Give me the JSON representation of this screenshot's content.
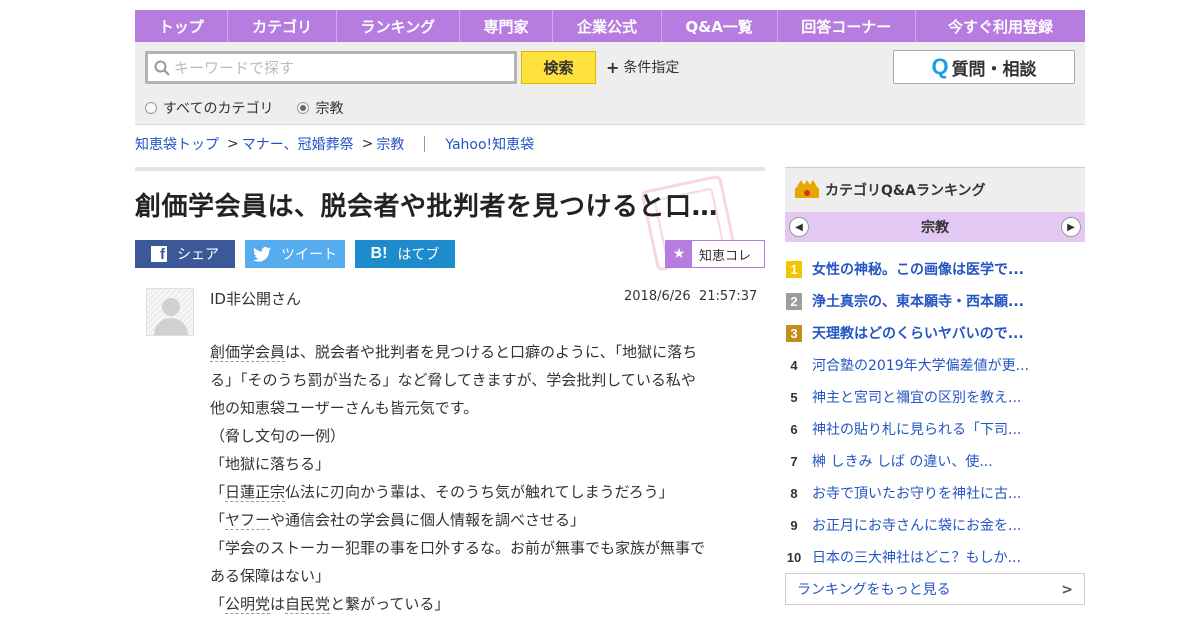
{
  "nav": {
    "items": [
      "トップ",
      "カテゴリ",
      "ランキング",
      "専門家",
      "企業公式",
      "Q&A一覧",
      "回答コーナー",
      "今すぐ利用登録"
    ]
  },
  "search": {
    "placeholder": "キーワードで探す",
    "value": "",
    "button_label": "検索",
    "condition_label": "条件指定",
    "ask_button_label": "質問・相談",
    "ask_icon": "Q",
    "scope_options": [
      "すべてのカテゴリ",
      "宗教"
    ],
    "scope_selected": "宗教"
  },
  "breadcrumb": {
    "items": [
      "知恵袋トップ",
      "マナー、冠婚葬祭",
      "宗教"
    ],
    "separator": ">",
    "service": "Yahoo!知恵袋"
  },
  "question": {
    "title": "創価学会員は、脱会者や批判者を見つけると口…",
    "user": "ID非公開さん",
    "date": "2018/6/26",
    "time": "21:57:37",
    "body_lines": [
      "は、脱会者や批判者を見つけると口癖のように、「地獄に落ち",
      "る」「そのうち罰が当たる」など脅してきますが、学会批判している私や",
      "他の知恵袋ユーザーさんも皆元気です。",
      "（脅し文句の一例）",
      "「地獄に落ちる」",
      "仏法に刃向かう輩は、そのうち気が触れてしまうだろう」",
      "や通信会社の学会員に個人情報を調べさせる」",
      "「学会のストーカー犯罪の事を口外するな。お前が無事でも家族が無事で",
      "ある保障はない」",
      "と繋がっている」"
    ],
    "keywords": {
      "k1": "創価学会員",
      "k2": "日蓮正宗",
      "k3": "ヤフー",
      "k4": "公明党",
      "k5": "自民党",
      "k5_join": "は"
    },
    "quote_open": "「"
  },
  "share": {
    "facebook": "シェア",
    "twitter": "ツイート",
    "hatena": "はてブ",
    "hatena_icon": "B!",
    "facebook_icon": "f",
    "collection": "知恵コレ"
  },
  "sidebar": {
    "title": "カテゴリQ&Aランキング",
    "category": "宗教",
    "ranking": [
      {
        "rank": "1",
        "text": "女性の神秘。この画像は医学で..."
      },
      {
        "rank": "2",
        "text": "浄土真宗の、東本願寺・西本願..."
      },
      {
        "rank": "3",
        "text": "天理教はどのくらいヤバいので..."
      },
      {
        "rank": "4",
        "text": "河合塾の2019年大学偏差値が更..."
      },
      {
        "rank": "5",
        "text": "神主と宮司と禰宜の区別を教え..."
      },
      {
        "rank": "6",
        "text": "神社の貼り札に見られる「下司..."
      },
      {
        "rank": "7",
        "text": "榊 しきみ しば の違い、使..."
      },
      {
        "rank": "8",
        "text": "お寺で頂いたお守りを神社に古..."
      },
      {
        "rank": "9",
        "text": "お正月にお寺さんに袋にお金を..."
      },
      {
        "rank": "10",
        "text": "日本の三大神社はどこ？もしか..."
      }
    ],
    "more_label": "ランキングをもっと見る"
  },
  "colors": {
    "nav_bg": "#b77ce0",
    "search_button": "#ffe13d",
    "link": "#2455c3",
    "facebook": "#3b5998",
    "twitter": "#55acee",
    "hatena": "#1e8bcd"
  }
}
